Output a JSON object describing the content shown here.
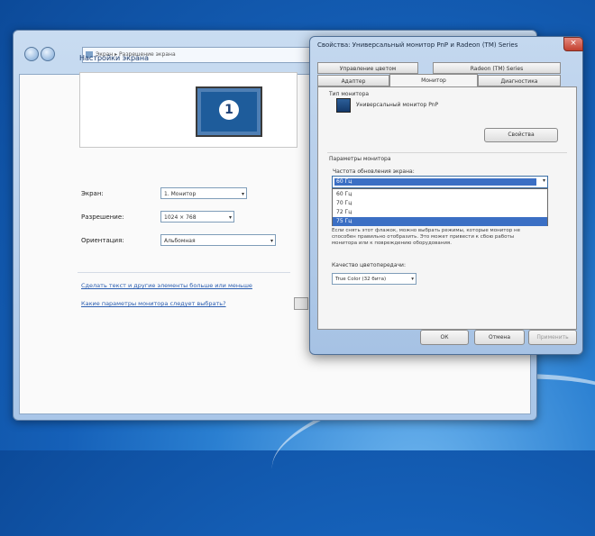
{
  "window": {
    "address": "Экран ▸ Разрешение экрана",
    "heading": "Настройки экрана",
    "monitor_number": "1",
    "display_label": "Экран:",
    "display_value": "1. Монитор",
    "resolution_label": "Разрешение:",
    "resolution_value": "1024 × 768",
    "orientation_label": "Ориентация:",
    "orientation_value": "Альбомная",
    "link1": "Сделать текст и другие элементы больше или меньше",
    "link2": "Какие параметры монитора следует выбрать?"
  },
  "dialog": {
    "title": "Свойства: Универсальный монитор PnP и Radeon (TM) Series",
    "close_glyph": "×",
    "tabs_top": [
      "Управление цветом",
      "Radeon (TM) Series"
    ],
    "tabs_bottom": [
      "Адаптер",
      "Монитор",
      "Диагностика"
    ],
    "monitor_type_label": "Тип монитора",
    "monitor_name": "Универсальный монитор PnP",
    "properties_button": "Свойства",
    "settings_label": "Параметры монитора",
    "refresh_label": "Частота обновления экрана:",
    "refresh_selected": "60 Гц",
    "refresh_options": [
      "60 Гц",
      "70 Гц",
      "72 Гц",
      "75 Гц"
    ],
    "refresh_highlight_index": 3,
    "description": "Если снять этот флажок, можно выбрать режимы, которые монитор не способен правильно отобразить. Это может привести к сбою работы монитора или к повреждению оборудования.",
    "colors_label": "Качество цветопередачи:",
    "colors_value": "True Color (32 бита)",
    "ok_button": "ОК",
    "cancel_button": "Отмена",
    "apply_button": "Применить"
  }
}
